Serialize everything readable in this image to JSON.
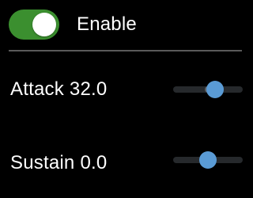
{
  "colors": {
    "background": "#000000",
    "toggle_on": "#3b8f2f",
    "slider_thumb": "#5a9bd5",
    "slider_track": "#26292c",
    "divider": "#5a5a5a"
  },
  "enable": {
    "label": "Enable",
    "state": true
  },
  "params": {
    "attack": {
      "name": "Attack",
      "value": "32.0",
      "level": 0.64
    },
    "sustain": {
      "name": "Sustain",
      "value": "0.0",
      "level": 0.5
    }
  }
}
